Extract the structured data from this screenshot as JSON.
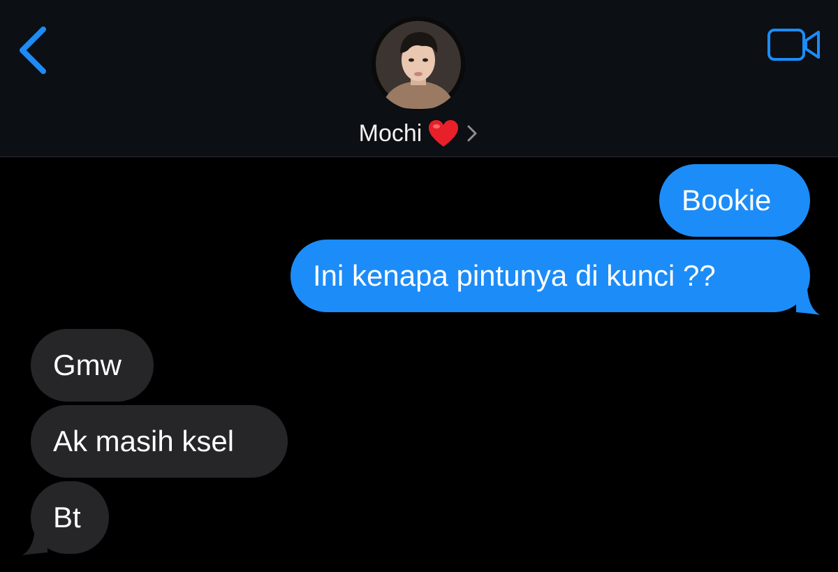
{
  "header": {
    "back_icon": "chevron-left-icon",
    "video_icon": "video-camera-icon",
    "contact_name": "Mochi",
    "contact_emoji_icon": "red-heart-icon",
    "disclosure_icon": "chevron-right-icon",
    "avatar_icon": "contact-photo"
  },
  "colors": {
    "accent": "#1c8cf8",
    "sent_bubble": "#1c8cf8",
    "received_bubble": "#262628",
    "background": "#000000",
    "header_background": "#0c0f14"
  },
  "messages": [
    {
      "direction": "sent",
      "text": "Bookie"
    },
    {
      "direction": "sent",
      "text": "Ini kenapa pintunya di kunci ??"
    },
    {
      "direction": "received",
      "text": "Gmw"
    },
    {
      "direction": "received",
      "text": "Ak masih ksel"
    },
    {
      "direction": "received",
      "text": "Bt"
    }
  ]
}
